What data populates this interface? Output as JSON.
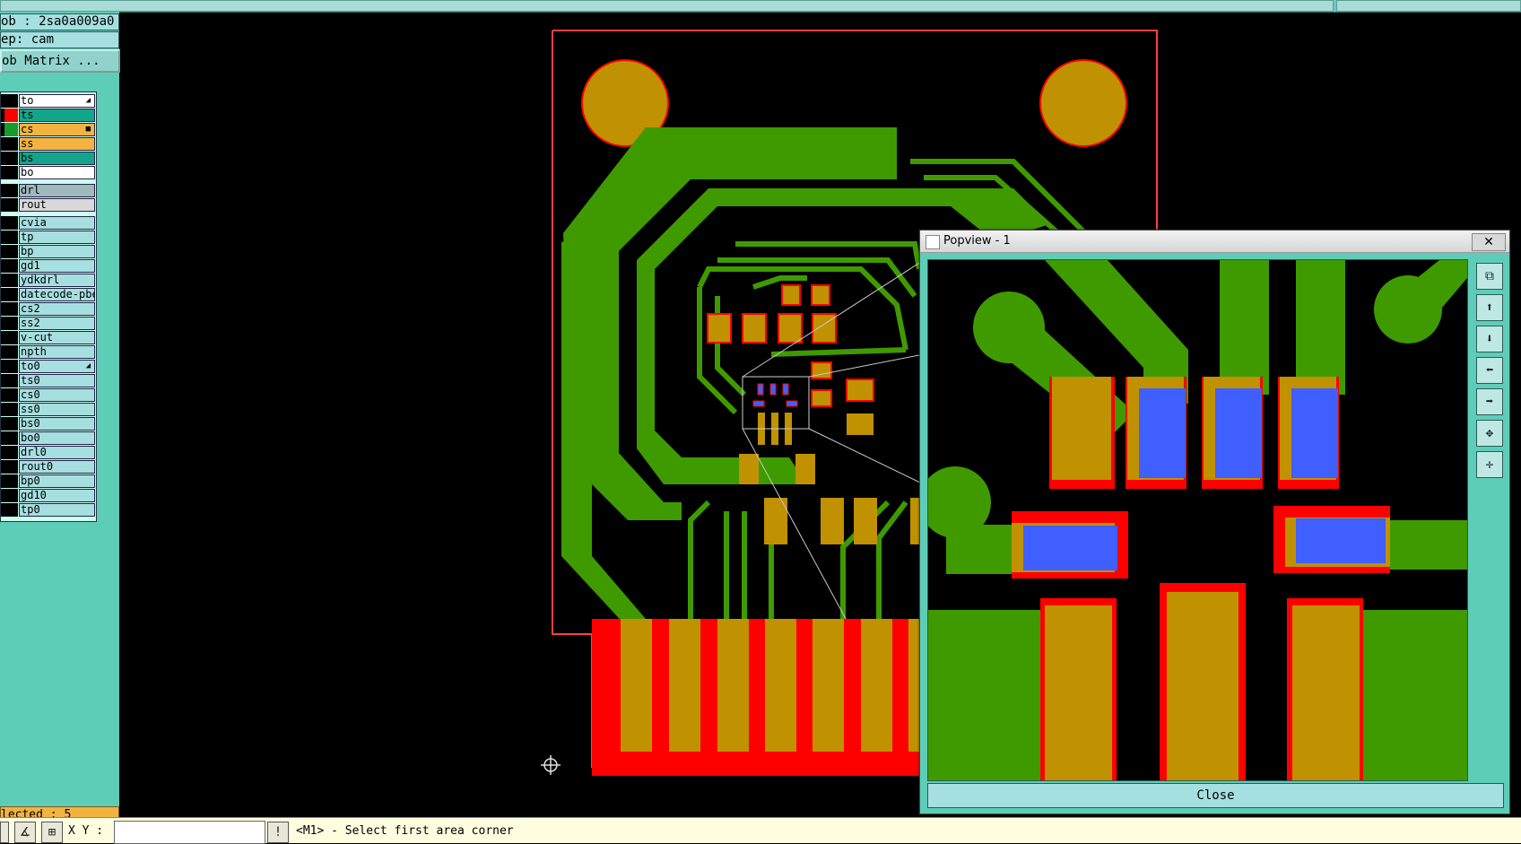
{
  "header": {
    "job_label": "ob : 2sa0a009a0",
    "step_label": "ep: cam",
    "matrix_button": "ob Matrix ..."
  },
  "layers": [
    {
      "name": "to",
      "bg": "#ffffff",
      "mark": "#000000",
      "suffix": "◢"
    },
    {
      "name": "ts",
      "bg": "#12a58b",
      "mark": "#ff0000",
      "suffix": ""
    },
    {
      "name": "cs",
      "bg": "#f2b340",
      "mark": "#1a9a2a",
      "suffix": "■"
    },
    {
      "name": "ss",
      "bg": "#f2b340",
      "mark": "#000000",
      "suffix": ""
    },
    {
      "name": "bs",
      "bg": "#12a58b",
      "mark": "#000000",
      "suffix": ""
    },
    {
      "name": "bo",
      "bg": "#ffffff",
      "mark": "#000000",
      "suffix": ""
    },
    {
      "name": "drl",
      "bg": "#9fb9bd",
      "mark": "#000000",
      "suffix": ""
    },
    {
      "name": "rout",
      "bg": "#d8d8d8",
      "mark": "#000000",
      "suffix": ""
    },
    {
      "name": "cvia",
      "bg": "#a6dfe0",
      "mark": "#000000",
      "suffix": ""
    },
    {
      "name": "tp",
      "bg": "#a6dfe0",
      "mark": "#000000",
      "suffix": ""
    },
    {
      "name": "bp",
      "bg": "#a6dfe0",
      "mark": "#000000",
      "suffix": ""
    },
    {
      "name": "gd1",
      "bg": "#a6dfe0",
      "mark": "#000000",
      "suffix": ""
    },
    {
      "name": "ydkdrl",
      "bg": "#a6dfe0",
      "mark": "#000000",
      "suffix": ""
    },
    {
      "name": "datecode-pbe",
      "bg": "#a6dfe0",
      "mark": "#000000",
      "suffix": ""
    },
    {
      "name": "cs2",
      "bg": "#a6dfe0",
      "mark": "#000000",
      "suffix": ""
    },
    {
      "name": "ss2",
      "bg": "#a6dfe0",
      "mark": "#000000",
      "suffix": ""
    },
    {
      "name": "v-cut",
      "bg": "#a6dfe0",
      "mark": "#000000",
      "suffix": ""
    },
    {
      "name": "npth",
      "bg": "#a6dfe0",
      "mark": "#000000",
      "suffix": ""
    },
    {
      "name": "to0",
      "bg": "#a6dfe0",
      "mark": "#000000",
      "suffix": "◢"
    },
    {
      "name": "ts0",
      "bg": "#a6dfe0",
      "mark": "#000000",
      "suffix": ""
    },
    {
      "name": "cs0",
      "bg": "#a6dfe0",
      "mark": "#000000",
      "suffix": ""
    },
    {
      "name": "ss0",
      "bg": "#a6dfe0",
      "mark": "#000000",
      "suffix": ""
    },
    {
      "name": "bs0",
      "bg": "#a6dfe0",
      "mark": "#000000",
      "suffix": ""
    },
    {
      "name": "bo0",
      "bg": "#a6dfe0",
      "mark": "#000000",
      "suffix": ""
    },
    {
      "name": "drl0",
      "bg": "#a6dfe0",
      "mark": "#000000",
      "suffix": ""
    },
    {
      "name": "rout0",
      "bg": "#a6dfe0",
      "mark": "#000000",
      "suffix": ""
    },
    {
      "name": "bp0",
      "bg": "#a6dfe0",
      "mark": "#000000",
      "suffix": ""
    },
    {
      "name": "gd10",
      "bg": "#a6dfe0",
      "mark": "#000000",
      "suffix": ""
    },
    {
      "name": "tp0",
      "bg": "#a6dfe0",
      "mark": "#000000",
      "suffix": ""
    }
  ],
  "selected_label": "lected : 5",
  "bottom": {
    "xy_label": "X Y :",
    "xy_value": "",
    "status": "<M1> - Select first area corner"
  },
  "popup": {
    "title": "Popview - 1",
    "close_label": "Close",
    "close_x": "✕"
  },
  "colors": {
    "copper": "#3f9a00",
    "pad": "#c09100",
    "mask": "#ff0000",
    "paste": "#3f5fff",
    "profile": "#ff4040"
  }
}
